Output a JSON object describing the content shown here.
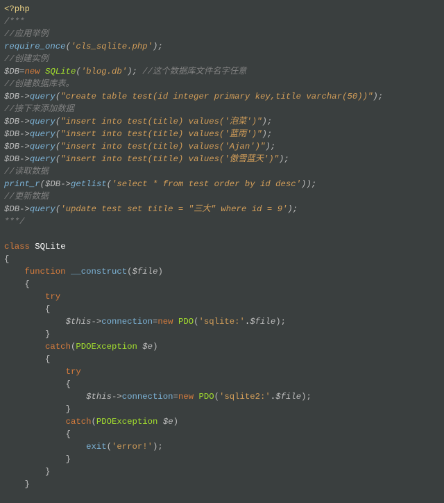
{
  "code": {
    "l0": "<?php",
    "l1": "/***",
    "l2": "//应用举例",
    "l3_fn": "require_once",
    "l3_str": "'cls_sqlite.php'",
    "l4": "//创建实例",
    "l5_var": "$DB",
    "l5_kw": "new",
    "l5_type": "SQLite",
    "l5_str": "'blog.db'",
    "l5_cmt": "//这个数据库文件名字任意",
    "l6": "//创建数据库表。",
    "l7_var": "$DB",
    "l7_fn": "query",
    "l7_str": "\"create table test(id integer primary key,title varchar(50))\"",
    "l8": "//接下来添加数据",
    "l9_var": "$DB",
    "l9_fn": "query",
    "l9_str": "\"insert into test(title) values('泡菜')\"",
    "l10_var": "$DB",
    "l10_fn": "query",
    "l10_str": "\"insert into test(title) values('蓝雨')\"",
    "l11_var": "$DB",
    "l11_fn": "query",
    "l11_str": "\"insert into test(title) values('Ajan')\"",
    "l12_var": "$DB",
    "l12_fn": "query",
    "l12_str": "\"insert into test(title) values('傲雪蓝天')\"",
    "l13": "//读取数据",
    "l14_fn1": "print_r",
    "l14_var": "$DB",
    "l14_fn2": "getlist",
    "l14_str": "'select * from test order by id desc'",
    "l15": "//更新数据",
    "l16_var": "$DB",
    "l16_fn": "query",
    "l16_str": "'update test set title = \"三大\" where id = 9'",
    "l17": "***/",
    "l18_kw": "class",
    "l18_name": "SQLite",
    "l19_kw": "function",
    "l19_fn": "__construct",
    "l19_var": "$file",
    "try_kw": "try",
    "catch_kw": "catch",
    "this_var": "$this",
    "conn_fn": "connection",
    "new_kw": "new",
    "pdo_type": "PDO",
    "pdo_str1": "'sqlite:'",
    "pdo_str2": "'sqlite2:'",
    "file_var": "$file",
    "pdoex_type": "PDOException",
    "e_var": "$e",
    "exit_fn": "exit",
    "exit_str": "'error!'"
  }
}
